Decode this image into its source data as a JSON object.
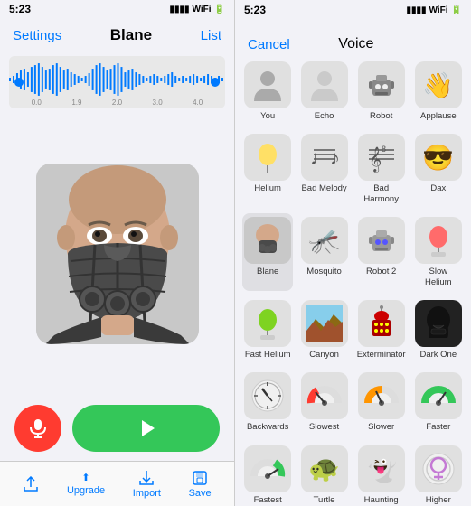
{
  "left": {
    "status_time": "5:23",
    "title": "Blane",
    "nav_left": "Settings",
    "nav_right": "List",
    "waveform_marks": [
      "0.0",
      "1.9",
      "2.0",
      "3.0",
      "4.0"
    ],
    "bottom_toolbar": [
      {
        "label": "Upgrade",
        "icon": "⬆"
      },
      {
        "label": "Import",
        "icon": "📥"
      },
      {
        "label": "Save",
        "icon": "💾"
      }
    ]
  },
  "right": {
    "status_time": "5:23",
    "cancel_label": "Cancel",
    "title": "Voice",
    "voices": [
      {
        "label": "You",
        "emoji": "🧍",
        "type": "person"
      },
      {
        "label": "Echo",
        "emoji": "🧍",
        "type": "person_gray"
      },
      {
        "label": "Robot",
        "emoji": "🤖",
        "type": "robot"
      },
      {
        "label": "Applause",
        "emoji": "👋",
        "type": "hand"
      },
      {
        "label": "Helium",
        "emoji": "🎈",
        "type": "balloon"
      },
      {
        "label": "Bad Melody",
        "emoji": "🎵",
        "type": "music"
      },
      {
        "label": "Bad Harmony",
        "emoji": "🎼",
        "type": "music2"
      },
      {
        "label": "Dax",
        "emoji": "😎",
        "type": "glasses"
      },
      {
        "label": "Blane",
        "emoji": "😷",
        "type": "mask",
        "selected": true
      },
      {
        "label": "Mosquito",
        "emoji": "🦟",
        "type": "mosquito"
      },
      {
        "label": "Robot 2",
        "emoji": "🤖",
        "type": "robot2"
      },
      {
        "label": "Slow Helium",
        "emoji": "🎈",
        "type": "balloon_red"
      },
      {
        "label": "Fast Helium",
        "emoji": "🎈",
        "type": "balloon_green"
      },
      {
        "label": "Canyon",
        "emoji": "🏔",
        "type": "canyon"
      },
      {
        "label": "Exterminator",
        "emoji": "👾",
        "type": "dalek"
      },
      {
        "label": "Dark One",
        "emoji": "🦹",
        "type": "darth"
      },
      {
        "label": "Backwards",
        "emoji": "⏰",
        "type": "clock_gauge"
      },
      {
        "label": "Slowest",
        "emoji": "🔴",
        "type": "gauge_red"
      },
      {
        "label": "Slower",
        "emoji": "🟡",
        "type": "gauge_yellow"
      },
      {
        "label": "Faster",
        "emoji": "🟢",
        "type": "gauge_green"
      },
      {
        "label": "Fastest",
        "emoji": "⚡",
        "type": "gauge_fastest"
      },
      {
        "label": "Turtle",
        "emoji": "🐢",
        "type": "turtle"
      },
      {
        "label": "Haunting",
        "emoji": "👻",
        "type": "ghost"
      },
      {
        "label": "Higher",
        "emoji": "♀",
        "type": "female"
      }
    ]
  }
}
